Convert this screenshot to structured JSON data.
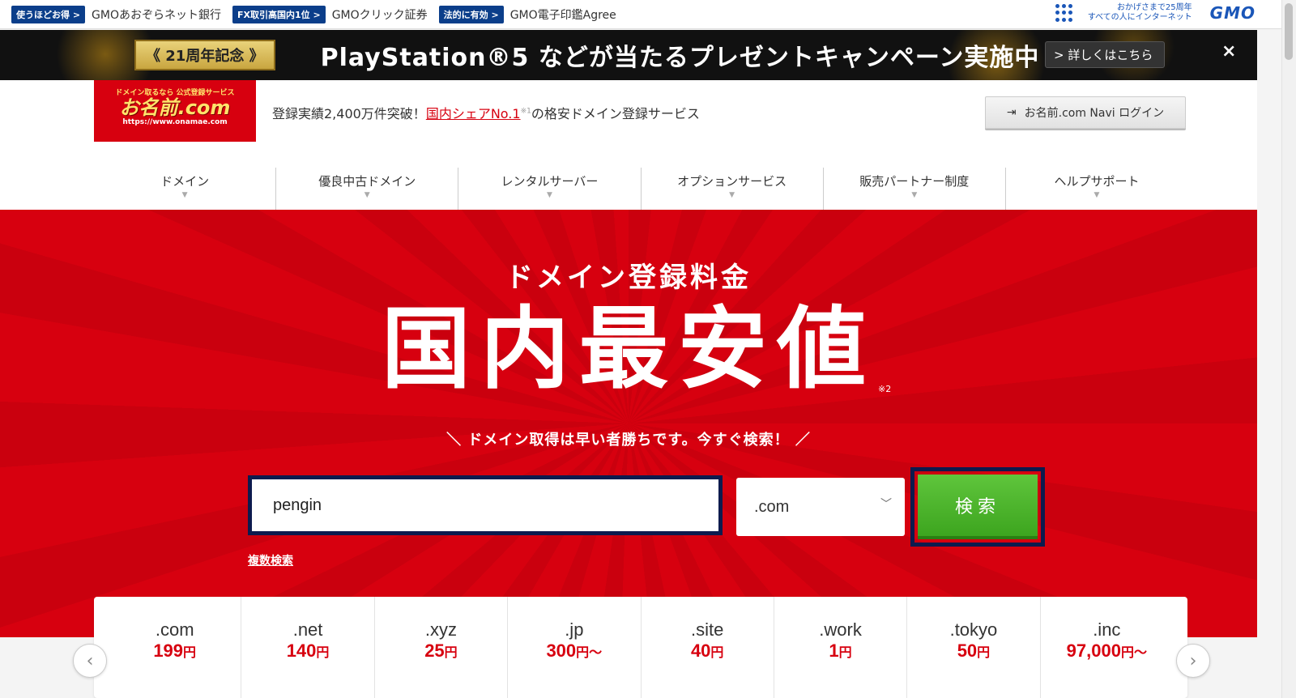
{
  "gmo_bar": {
    "links": [
      {
        "badge": "使うほどお得 >",
        "label": "GMOあおぞらネット銀行"
      },
      {
        "badge": "FX取引高国内1位 >",
        "label": "GMOクリック証券"
      },
      {
        "badge": "法的に有効 >",
        "label": "GMO電子印鑑Agree"
      }
    ],
    "thanks_line1": "おかげさまで25周年",
    "thanks_line2": "すべての人にインターネット",
    "logo": "GMO"
  },
  "banner": {
    "anniversary": "《 21周年記念 》",
    "campaign": "PlayStation®5 などが当たるプレゼントキャンペーン実施中",
    "detail_label": "> 詳しくはこちら",
    "close": "×"
  },
  "header": {
    "logo_top": "ドメイン取るなら 公式登録サービス",
    "logo_main": "お名前.com",
    "logo_url": "https://www.onamae.com",
    "tagline_pre": "登録実績2,400万件突破！",
    "tagline_share": "国内シェアNo.1",
    "tagline_note": "※1",
    "tagline_post": "の格安ドメイン登録サービス",
    "login_label": "お名前.com Navi ログイン"
  },
  "nav": {
    "items": [
      "ドメイン",
      "優良中古ドメイン",
      "レンタルサーバー",
      "オプションサービス",
      "販売パートナー制度",
      "ヘルプサポート"
    ]
  },
  "hero": {
    "sub": "ドメイン登録料金",
    "main": "国内最安値",
    "note": "※2",
    "lead": "＼  ドメイン取得は早い者勝ちです。今すぐ検索！  ／",
    "search_value": "pengin",
    "tld_selected": ".com",
    "search_button": "検索",
    "multi_search": "複数検索"
  },
  "prices": [
    {
      "tld": ".com",
      "price": "199",
      "unit": "円"
    },
    {
      "tld": ".net",
      "price": "140",
      "unit": "円"
    },
    {
      "tld": ".xyz",
      "price": "25",
      "unit": "円"
    },
    {
      "tld": ".jp",
      "price": "300",
      "unit": "円〜"
    },
    {
      "tld": ".site",
      "price": "40",
      "unit": "円"
    },
    {
      "tld": ".work",
      "price": "1",
      "unit": "円"
    },
    {
      "tld": ".tokyo",
      "price": "50",
      "unit": "円"
    },
    {
      "tld": ".inc",
      "price": "97,000",
      "unit": "円〜"
    }
  ],
  "carousel": {
    "prev": "‹",
    "next": "›"
  },
  "colors": {
    "brand_red": "#d7000f",
    "gmo_blue": "#0b3e8a",
    "search_green": "#4cb52b"
  }
}
